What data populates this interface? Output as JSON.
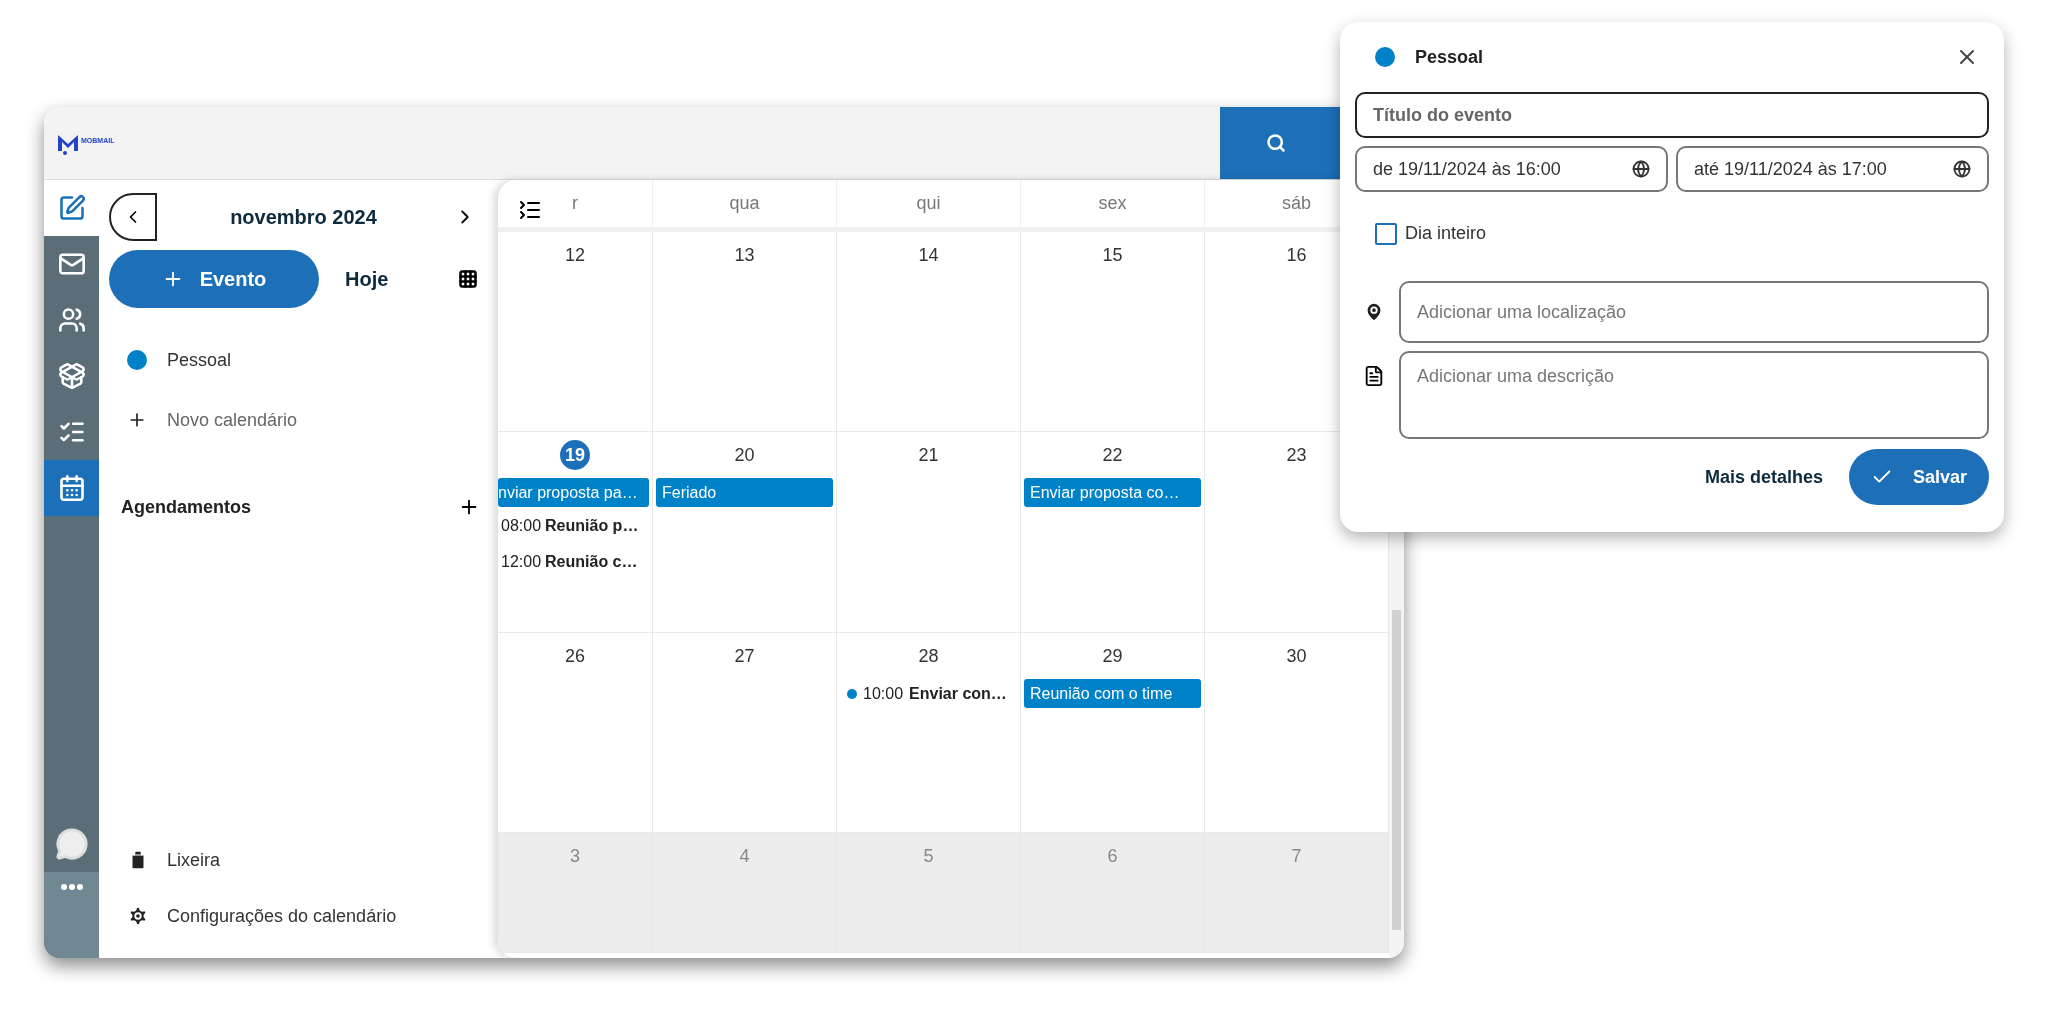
{
  "app": {
    "logo": "MOBMAIL",
    "rail": [
      {
        "kind": "compose",
        "selected": false
      },
      {
        "kind": "mail",
        "selected": false
      },
      {
        "kind": "contacts",
        "selected": false
      },
      {
        "kind": "box",
        "selected": false
      },
      {
        "kind": "tasks",
        "selected": false
      },
      {
        "kind": "calendar",
        "selected": true
      }
    ],
    "sidebar": {
      "month": "novembro 2024",
      "new_event": "Evento",
      "today": "Hoje",
      "calendars": [
        {
          "name": "Pessoal",
          "color": "#0082c8"
        }
      ],
      "new_calendar": "Novo calendário",
      "section": "Agendamentos",
      "footer": [
        {
          "kind": "trash",
          "label": "Lixeira"
        },
        {
          "kind": "settings",
          "label": "Configurações do calendário"
        }
      ]
    },
    "calendar": {
      "weekdays": [
        "r",
        "qua",
        "qui",
        "sex",
        "sáb"
      ],
      "weeks": [
        {
          "days": [
            {
              "number": "12",
              "today": false,
              "outside": false
            },
            {
              "number": "13",
              "today": false,
              "outside": false
            },
            {
              "number": "14",
              "today": false,
              "outside": false
            },
            {
              "number": "15",
              "today": false,
              "outside": false
            },
            {
              "number": "16",
              "today": false,
              "outside": false
            }
          ]
        },
        {
          "days": [
            {
              "number": "19",
              "today": true,
              "outside": false,
              "events": [
                {
                  "kind": "bar",
                  "title": "nviar proposta pa…"
                },
                {
                  "kind": "timed",
                  "time": "08:00",
                  "title": "Reunião p…"
                },
                {
                  "kind": "timed",
                  "time": "12:00",
                  "title": "Reunião c…"
                }
              ]
            },
            {
              "number": "20",
              "today": false,
              "outside": false,
              "events": [
                {
                  "kind": "bar",
                  "title": "Feriado"
                }
              ]
            },
            {
              "number": "21",
              "today": false,
              "outside": false
            },
            {
              "number": "22",
              "today": false,
              "outside": false,
              "events": [
                {
                  "kind": "bar",
                  "title": "Enviar proposta co…"
                }
              ]
            },
            {
              "number": "23",
              "today": false,
              "outside": false
            }
          ]
        },
        {
          "days": [
            {
              "number": "26",
              "today": false,
              "outside": false
            },
            {
              "number": "27",
              "today": false,
              "outside": false
            },
            {
              "number": "28",
              "today": false,
              "outside": false,
              "events": [
                {
                  "kind": "dot",
                  "time": "10:00",
                  "title": "Enviar con…"
                }
              ]
            },
            {
              "number": "29",
              "today": false,
              "outside": false,
              "events": [
                {
                  "kind": "bar",
                  "title": "Reunião com o time"
                }
              ]
            },
            {
              "number": "30",
              "today": false,
              "outside": false
            }
          ]
        },
        {
          "days": [
            {
              "number": "3",
              "today": false,
              "outside": true
            },
            {
              "number": "4",
              "today": false,
              "outside": true
            },
            {
              "number": "5",
              "today": false,
              "outside": true
            },
            {
              "number": "6",
              "today": false,
              "outside": true
            },
            {
              "number": "7",
              "today": false,
              "outside": true
            }
          ]
        }
      ]
    }
  },
  "popup": {
    "calendar": {
      "name": "Pessoal",
      "color": "#0082c8"
    },
    "title_placeholder": "Título do evento",
    "start": "de 19/11/2024 às 16:00",
    "end": "até 19/11/2024 às 17:00",
    "all_day": {
      "label": "Dia inteiro",
      "checked": false
    },
    "location_placeholder": "Adicionar uma localização",
    "description_placeholder": "Adicionar uma descrição",
    "more": "Mais detalhes",
    "save": "Salvar"
  }
}
